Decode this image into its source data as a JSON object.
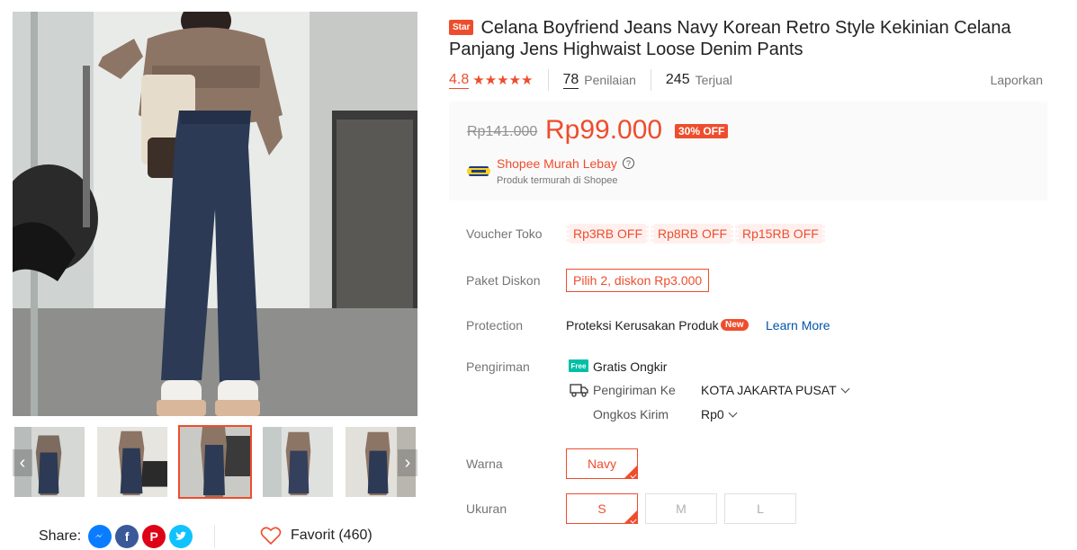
{
  "gallery": {
    "thumbnails": [
      {
        "label": "thumbnail-1"
      },
      {
        "label": "thumbnail-2"
      },
      {
        "label": "thumbnail-3",
        "active": true
      },
      {
        "label": "thumbnail-4"
      },
      {
        "label": "thumbnail-5"
      }
    ],
    "prev_arrow": "‹",
    "next_arrow": "›"
  },
  "share": {
    "label": "Share:",
    "icons": [
      "messenger-icon",
      "facebook-icon",
      "pinterest-icon",
      "twitter-icon"
    ],
    "colors": {
      "messenger": "#0a7cff",
      "facebook": "#3b5999",
      "pinterest": "#de0217",
      "twitter": "#10c2ff"
    }
  },
  "favorite": {
    "label": "Favorit (460)"
  },
  "product": {
    "badge": "Star",
    "title": "Celana Boyfriend Jeans Navy Korean Retro Style Kekinian Celana Panjang Jens Highwaist Loose Denim Pants"
  },
  "stats": {
    "rating": "4.8",
    "stars": "★★★★★",
    "reviews_count": "78",
    "reviews_label": "Penilaian",
    "sold_count": "245",
    "sold_label": "Terjual",
    "report": "Laporkan"
  },
  "price": {
    "original": "Rp141.000",
    "current": "Rp99.000",
    "discount": "30% OFF",
    "promo_title": "Shopee Murah Lebay",
    "promo_help": "?",
    "promo_subtitle": "Produk termurah di Shopee"
  },
  "details": {
    "voucher_label": "Voucher Toko",
    "vouchers": [
      "Rp3RB OFF",
      "Rp8RB OFF",
      "Rp15RB OFF"
    ],
    "paket_label": "Paket Diskon",
    "paket_value": "Pilih 2, diskon Rp3.000",
    "protection_label": "Protection",
    "protection_value": "Proteksi Kerusakan Produk",
    "protection_badge": "New",
    "learn_more": "Learn More",
    "shipping_label": "Pengiriman",
    "free_icon_text": "Free",
    "free_shipping": "Gratis Ongkir",
    "ship_to_label": "Pengiriman Ke",
    "ship_to_value": "KOTA JAKARTA PUSAT",
    "ship_cost_label": "Ongkos Kirim",
    "ship_cost_value": "Rp0"
  },
  "variants": {
    "color_label": "Warna",
    "colors": [
      "Navy"
    ],
    "size_label": "Ukuran",
    "sizes": [
      "S",
      "M",
      "L"
    ],
    "selected_color": "Navy",
    "selected_size": "S"
  },
  "theme": {
    "accent": "#ee4d2d",
    "link": "#0055aa",
    "muted": "#757575"
  }
}
